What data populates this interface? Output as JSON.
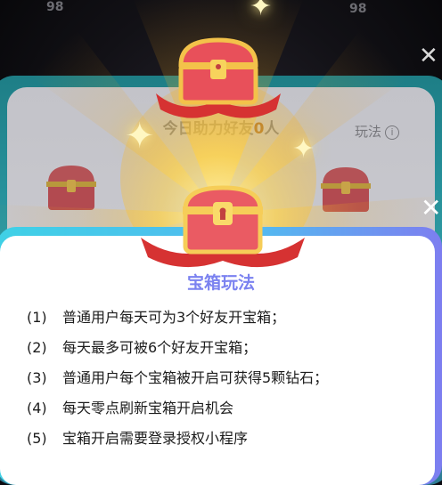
{
  "background": {
    "badge_left": "98",
    "badge_right": "98",
    "title_prefix": "今日助力好友",
    "title_count": "0",
    "title_suffix": "人",
    "rules_link": "玩法",
    "info_icon_glyph": "i"
  },
  "close_glyph": "✕",
  "modal": {
    "title": "宝箱玩法",
    "rules": [
      {
        "num": "(1)",
        "text": "普通用户每天可为3个好友开宝箱；"
      },
      {
        "num": "(2)",
        "text": "每天最多可被6个好友开宝箱；"
      },
      {
        "num": "(3)",
        "text": "普通用户每个宝箱被开启可获得5颗钻石；"
      },
      {
        "num": "(4)",
        "text": "每天零点刷新宝箱开启机会"
      },
      {
        "num": "(5)",
        "text": "宝箱开启需要登录授权小程序"
      }
    ]
  },
  "colors": {
    "modal_title": "#7b82f0",
    "modal_border_start": "#3fd1e6",
    "modal_border_end": "#7d7ef0",
    "chest_red": "#e8505a",
    "chest_gold": "#f3c24a",
    "ribbon_red": "#d63232"
  },
  "icons": {
    "chest": "treasure-chest-icon",
    "sparkle": "sparkle-icon",
    "close": "close-icon",
    "info": "info-icon"
  }
}
